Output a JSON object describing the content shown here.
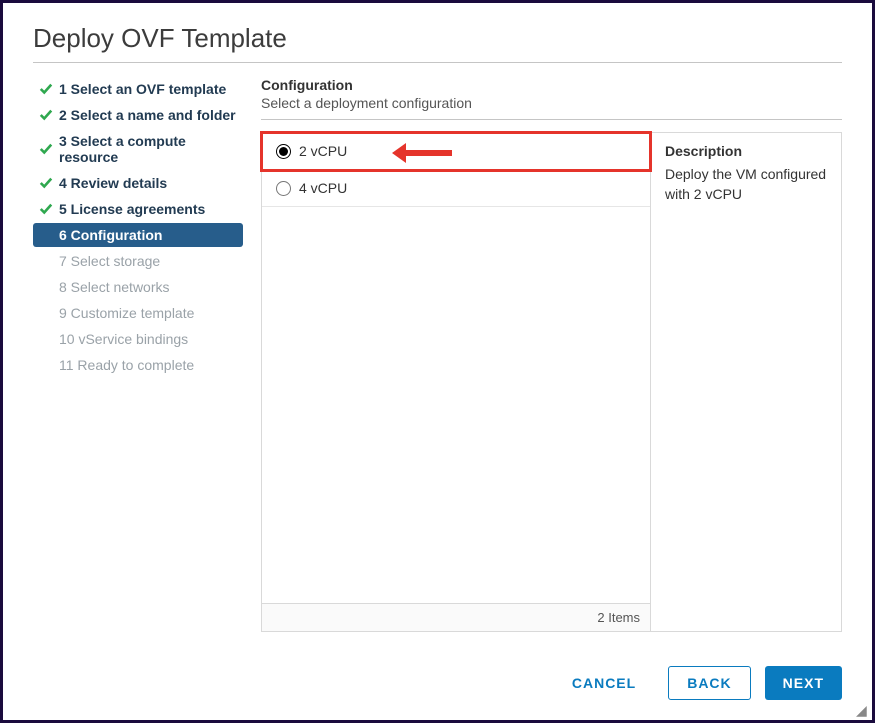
{
  "dialog": {
    "title": "Deploy OVF Template"
  },
  "sidebar": {
    "steps": [
      {
        "label": "1 Select an OVF template",
        "state": "done"
      },
      {
        "label": "2 Select a name and folder",
        "state": "done"
      },
      {
        "label": "3 Select a compute resource",
        "state": "done"
      },
      {
        "label": "4 Review details",
        "state": "done"
      },
      {
        "label": "5 License agreements",
        "state": "done"
      },
      {
        "label": "6 Configuration",
        "state": "active"
      },
      {
        "label": "7 Select storage",
        "state": "pending"
      },
      {
        "label": "8 Select networks",
        "state": "pending"
      },
      {
        "label": "9 Customize template",
        "state": "pending"
      },
      {
        "label": "10 vService bindings",
        "state": "pending"
      },
      {
        "label": "11 Ready to complete",
        "state": "pending"
      }
    ]
  },
  "main": {
    "heading": "Configuration",
    "subheading": "Select a deployment configuration",
    "options": [
      {
        "label": "2 vCPU",
        "selected": true,
        "highlight": true
      },
      {
        "label": "4 vCPU",
        "selected": false,
        "highlight": false
      }
    ],
    "items_footer": "2 Items",
    "description": {
      "title": "Description",
      "text": "Deploy the VM configured with 2 vCPU"
    }
  },
  "footer": {
    "cancel": "CANCEL",
    "back": "BACK",
    "next": "NEXT"
  }
}
